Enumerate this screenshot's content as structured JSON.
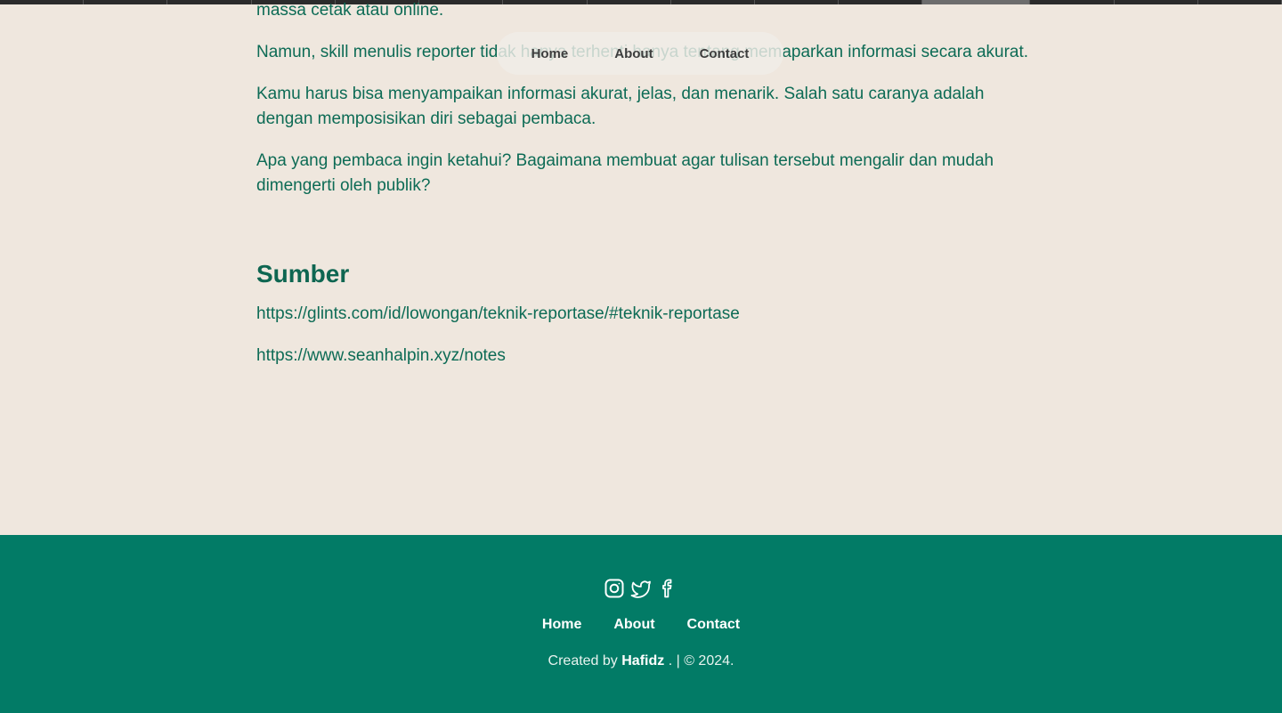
{
  "article": {
    "paragraphs": [
      "massa cetak atau online.",
      "Namun, skill menulis reporter tidak hanya terhenti hanya tentang memaparkan informasi secara akurat.",
      "Kamu harus bisa menyampaikan informasi akurat, jelas, dan menarik. Salah satu caranya adalah dengan memposisikan diri sebagai pembaca.",
      "Apa yang pembaca ingin ketahui? Bagaimana membuat agar tulisan tersebut mengalir dan mudah dimengerti oleh publik?"
    ],
    "sources_heading": "Sumber",
    "sources": [
      "https://glints.com/id/lowongan/teknik-reportase/#teknik-reportase",
      "https://www.seanhalpin.xyz/notes"
    ]
  },
  "nav": {
    "home": "Home",
    "about": "About",
    "contact": "Contact"
  },
  "footer": {
    "social_icons": [
      "instagram-icon",
      "twitter-icon",
      "facebook-icon"
    ],
    "nav": {
      "home": "Home",
      "about": "About",
      "contact": "Contact"
    },
    "credit_prefix": "Created by",
    "credit_name": "Hafidz",
    "credit_suffix": ". | © 2024."
  },
  "colors": {
    "background": "#efe7de",
    "text": "#0d6b55",
    "footer": "#027b66"
  }
}
